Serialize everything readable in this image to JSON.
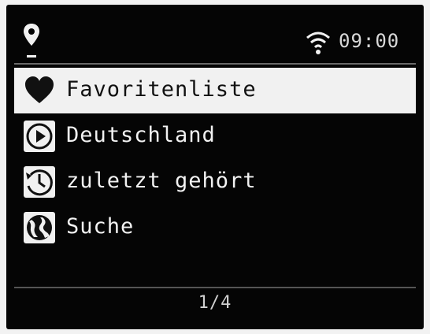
{
  "status": {
    "icons": {
      "location": "location-pin-icon",
      "wifi": "wifi-icon"
    },
    "time": "09:00"
  },
  "menu": {
    "items": [
      {
        "label": "Favoritenliste",
        "icon": "heart-icon",
        "selected": true
      },
      {
        "label": "Deutschland",
        "icon": "play-icon",
        "selected": false
      },
      {
        "label": "zuletzt gehört",
        "icon": "history-clock-icon",
        "selected": false
      },
      {
        "label": "Suche",
        "icon": "globe-icon",
        "selected": false
      }
    ]
  },
  "pager": {
    "text": "1/4"
  },
  "colors": {
    "background": "#050505",
    "highlight": "#f1f1f1",
    "text": "#f2f2f2"
  }
}
